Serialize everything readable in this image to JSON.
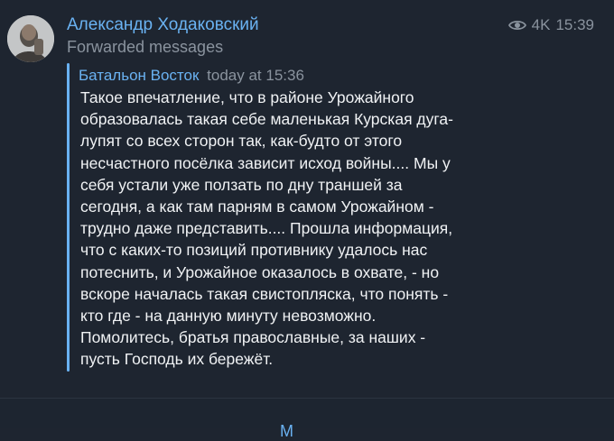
{
  "post": {
    "sender": "Александр Ходаковский",
    "forwarded_label": "Forwarded messages",
    "views": "4K",
    "time": "15:39"
  },
  "forward": {
    "channel": "Батальон Восток",
    "time": "today at 15:36",
    "lines": [
      "Такое впечатление, что в районе Урожайного",
      "образовалась такая себе маленькая Курская дуга-",
      "лупят со всех сторон так, как-будто от этого",
      "несчастного посёлка зависит исход войны.... Мы у",
      "себя устали уже ползать по дну траншей за",
      "сегодня, а как там парням в самом Урожайном -",
      "трудно даже представить.... Прошла информация,",
      "что с каких-то позиций противнику удалось нас",
      "потеснить, и Урожайное оказалось в охвате, - но",
      "вскоре началась такая свистопляска, что понять -",
      "кто где - на данную минуту невозможно.",
      "Помолитесь, братья православные, за наших -",
      "пусть Господь их бережёт."
    ]
  },
  "next_message": {
    "partial_text": "M"
  },
  "colors": {
    "background": "#1e2530",
    "accent": "#6ab2f2",
    "muted": "#8a939e",
    "text": "#f0f2f4"
  },
  "icons": {
    "views": "eye-icon",
    "avatar": "avatar"
  }
}
